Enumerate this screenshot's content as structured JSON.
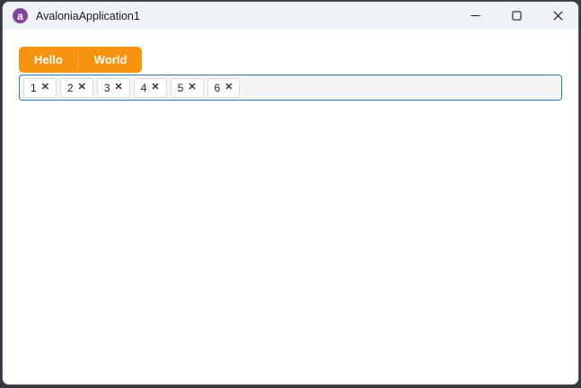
{
  "window": {
    "title": "AvaloniaApplication1",
    "logo_letter": "a",
    "controls": [
      {
        "name": "minimize"
      },
      {
        "name": "maximize"
      },
      {
        "name": "close"
      }
    ]
  },
  "tabs": [
    {
      "label": "Hello",
      "selected": true
    },
    {
      "label": "World",
      "selected": false
    }
  ],
  "tag_input": {
    "chips": [
      {
        "label": "1"
      },
      {
        "label": "2"
      },
      {
        "label": "3"
      },
      {
        "label": "4"
      },
      {
        "label": "5"
      },
      {
        "label": "6"
      }
    ],
    "remove_glyph": "✕"
  },
  "colors": {
    "accent-orange": "#F7930E",
    "tab-divider": "#F9A84E",
    "focus-border": "#2E7CB5",
    "titlebar-bg": "#F0F3F6",
    "window-outline": "#35383C",
    "chip-border": "#D7DADE",
    "logo-purple": "#8343A5"
  }
}
